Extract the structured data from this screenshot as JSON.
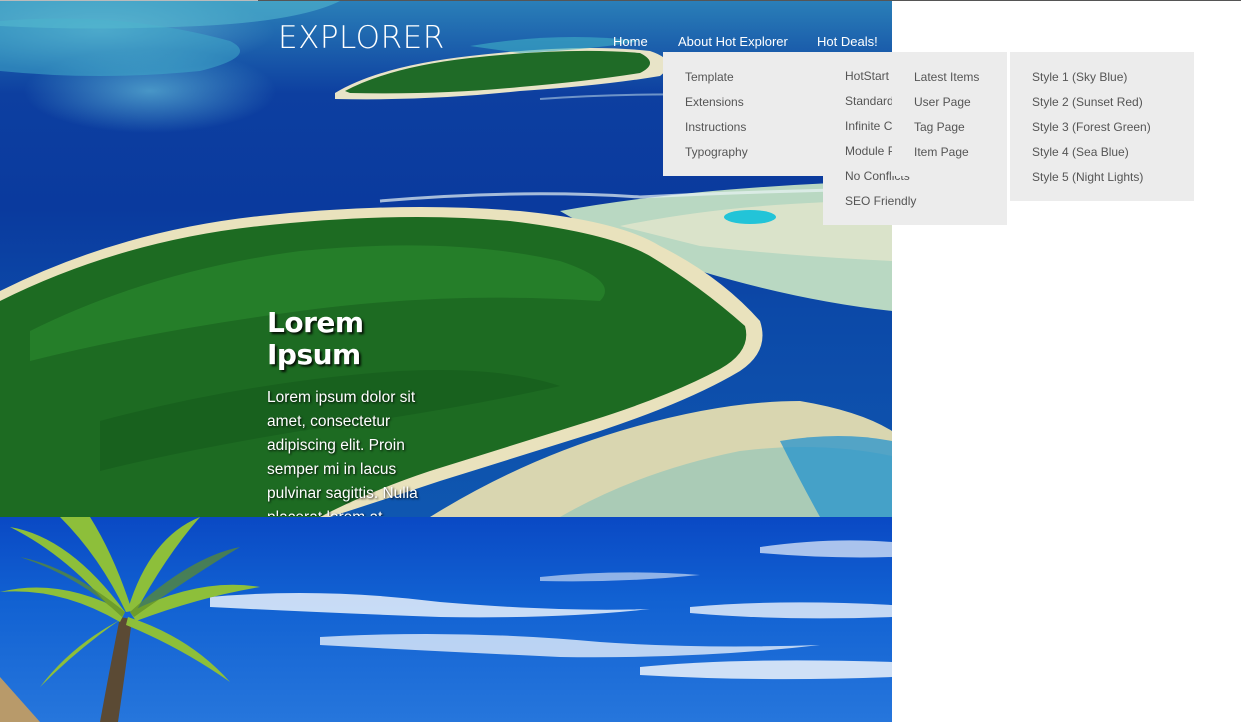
{
  "header": {
    "logo": "EXPLORER",
    "nav": {
      "home": "Home",
      "about": "About Hot Explorer",
      "deals": "Hot Deals!"
    }
  },
  "menus": {
    "about": [
      "Template",
      "Extensions",
      "Instructions",
      "Typography"
    ],
    "features": [
      "HotStart",
      "Standard",
      "Infinite Cl",
      "Module P",
      "No Conflicts",
      "SEO Friendly"
    ],
    "pages": [
      "Latest Items",
      "User Page",
      "Tag Page",
      "Item Page"
    ],
    "styles": [
      "Style 1 (Sky Blue)",
      "Style 2 (Sunset Red)",
      "Style 3 (Forest Green)",
      "Style 4 (Sea Blue)",
      "Style 5 (Night Lights)"
    ]
  },
  "hero": {
    "title": "Lorem Ipsum",
    "body": "Lorem ipsum dolor sit amet, consectetur adipiscing elit. Proin semper mi in lacus pulvinar sagittis. Nulla placerat lorem at"
  },
  "colors": {
    "menu_bg": "#ececec",
    "menu_text": "#555555",
    "nav_text": "#ffffff"
  }
}
